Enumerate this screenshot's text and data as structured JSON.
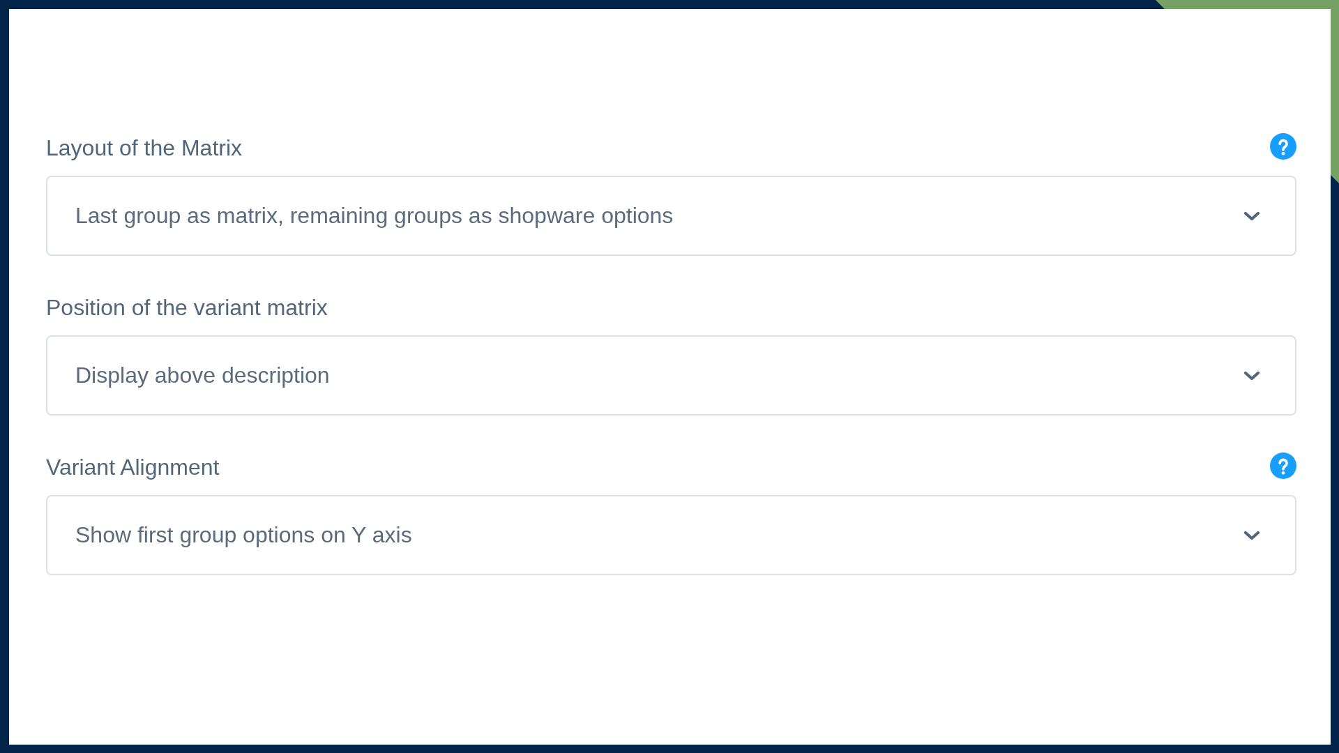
{
  "fields": [
    {
      "label": "Layout of the Matrix",
      "help": true,
      "value": "Last group as matrix, remaining groups as shopware options"
    },
    {
      "label": "Position of the variant matrix",
      "help": false,
      "value": "Display above description"
    },
    {
      "label": "Variant Alignment",
      "help": true,
      "value": "Show first group options on Y axis"
    }
  ]
}
